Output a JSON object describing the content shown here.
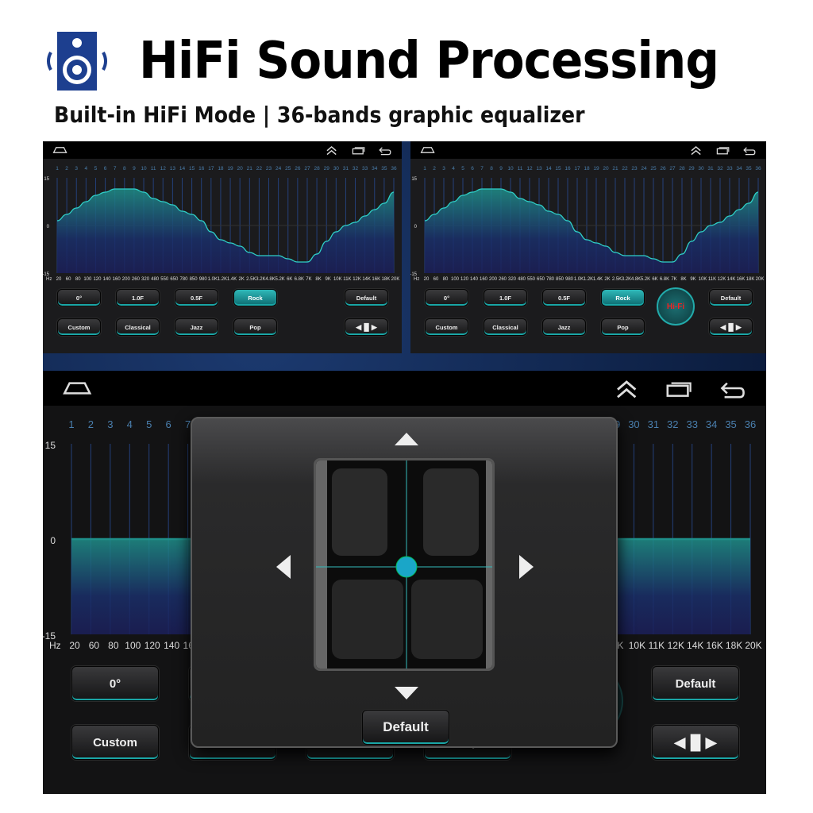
{
  "header": {
    "title": "HiFi Sound Processing",
    "subtitle": "Built-in HiFi Mode | 36-bands graphic equalizer",
    "icon": "speaker-icon",
    "icon_color": "#1d3f8f"
  },
  "nav_icons": [
    "home-icon",
    "double-chevron-up-icon",
    "recent-apps-icon",
    "back-icon"
  ],
  "eq": {
    "bands": [
      "1",
      "2",
      "3",
      "4",
      "5",
      "6",
      "7",
      "8",
      "9",
      "10",
      "11",
      "12",
      "13",
      "14",
      "15",
      "16",
      "17",
      "18",
      "19",
      "20",
      "21",
      "22",
      "23",
      "24",
      "25",
      "26",
      "27",
      "28",
      "29",
      "30",
      "31",
      "32",
      "33",
      "34",
      "35",
      "36"
    ],
    "unit": "Hz",
    "freqs": [
      "20",
      "60",
      "80",
      "100",
      "120",
      "140",
      "160",
      "200",
      "260",
      "320",
      "480",
      "550",
      "650",
      "780",
      "850",
      "980",
      "1.0K",
      "1.2K",
      "1.4K",
      "2K",
      "2.5K",
      "3.2K",
      "4.8K",
      "5.2K",
      "6K",
      "6.8K",
      "7K",
      "8K",
      "9K",
      "10K",
      "11K",
      "12K",
      "14K",
      "16K",
      "18K",
      "20K"
    ],
    "y_ticks": [
      "15",
      "0",
      "-15"
    ],
    "ylim": [
      -15,
      15
    ],
    "rock_gains": [
      1.5,
      3.5,
      5.5,
      7.5,
      9.5,
      10.5,
      11.5,
      11.5,
      11.5,
      10.5,
      8.5,
      7.5,
      6.5,
      4.5,
      3.5,
      1.5,
      -2,
      -4.5,
      -5.5,
      -6.5,
      -8.5,
      -9.5,
      -9.5,
      -9.5,
      -10.5,
      -11.5,
      -11.5,
      -9,
      -5,
      -2,
      0,
      1,
      3,
      5,
      7,
      10.5
    ],
    "accent": "#2fd0c8"
  },
  "buttons": {
    "angle": "0°",
    "f10": "1.0F",
    "f05": "0.5F",
    "rock": "Rock",
    "default": "Default",
    "custom": "Custom",
    "classical": "Classical",
    "jazz": "Jazz",
    "pop": "Pop",
    "hifi": "Hi-Fi",
    "sound_icon": "speaker-balance-icon"
  },
  "dialog": {
    "default_label": "Default",
    "up": "arrow-up-icon",
    "down": "arrow-down-icon",
    "left": "arrow-left-icon",
    "right": "arrow-right-icon"
  }
}
